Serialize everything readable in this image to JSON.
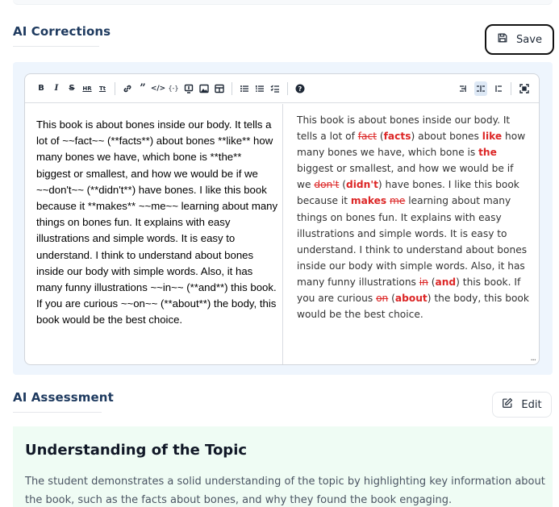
{
  "corrections": {
    "title": "AI Corrections",
    "save_label": "Save",
    "markdown_text": "This book is about bones inside our body. It tells a lot of ~~fact~~ (**facts**) about bones **like** how many bones we have, which bone is **the** biggest or smallest, and how we would be if we ~~don't~~ (**didn't**) have bones. I like this book because it **makes** ~~me~~ learning about many things on bones fun. It explains with easy illustrations and simple words. It is easy to understand. I think to understand about bones inside our body with simple words. Also, it has many funny illustrations ~~in~~ (**and**) this book. If you are curious ~~on~~ (**about**) the body, this book would be the best choice.",
    "preview_segments": [
      {
        "t": "This book is about bones inside our body. It tells a lot of ",
        "k": "n"
      },
      {
        "t": "fact",
        "k": "d"
      },
      {
        "t": " (",
        "k": "n"
      },
      {
        "t": "facts",
        "k": "i"
      },
      {
        "t": ") about bones ",
        "k": "n"
      },
      {
        "t": "like",
        "k": "i"
      },
      {
        "t": " how many bones we have, which bone is ",
        "k": "n"
      },
      {
        "t": "the",
        "k": "i"
      },
      {
        "t": " biggest or smallest, and how we would be if we ",
        "k": "n"
      },
      {
        "t": "don't",
        "k": "d"
      },
      {
        "t": " (",
        "k": "n"
      },
      {
        "t": "didn't",
        "k": "i"
      },
      {
        "t": ") have bones. I like this book because it ",
        "k": "n"
      },
      {
        "t": "makes",
        "k": "i"
      },
      {
        "t": " ",
        "k": "n"
      },
      {
        "t": "me",
        "k": "d"
      },
      {
        "t": " learning about many things on bones fun. It explains with easy illustrations and simple words. It is easy to understand. I think to understand about bones inside our body with simple words. Also, it has many funny illustrations ",
        "k": "n"
      },
      {
        "t": "in",
        "k": "d"
      },
      {
        "t": " (",
        "k": "n"
      },
      {
        "t": "and",
        "k": "i"
      },
      {
        "t": ") this book. If you are curious ",
        "k": "n"
      },
      {
        "t": "on",
        "k": "d"
      },
      {
        "t": " (",
        "k": "n"
      },
      {
        "t": "about",
        "k": "i"
      },
      {
        "t": ") the body, this book would be the best choice.",
        "k": "n"
      }
    ],
    "toolbar": {
      "bold": "B",
      "italic": "I",
      "strikethrough": "S",
      "hr": "HR",
      "title": "Tt",
      "active_view": "side-by-side"
    },
    "resize_glyph": "..."
  },
  "assessment": {
    "title": "AI Assessment",
    "edit_label": "Edit",
    "heading": "Understanding of the Topic",
    "body": "The student demonstrates a solid understanding of the topic by highlighting key information about the book, such as the facts about bones, and why they found the book engaging."
  },
  "colors": {
    "title": "#1e3a5f",
    "correction_red": "#dc2626",
    "editor_bg": "#eef5fd",
    "assessment_bg": "#effcf4",
    "active_tool": "#dde8f5"
  }
}
